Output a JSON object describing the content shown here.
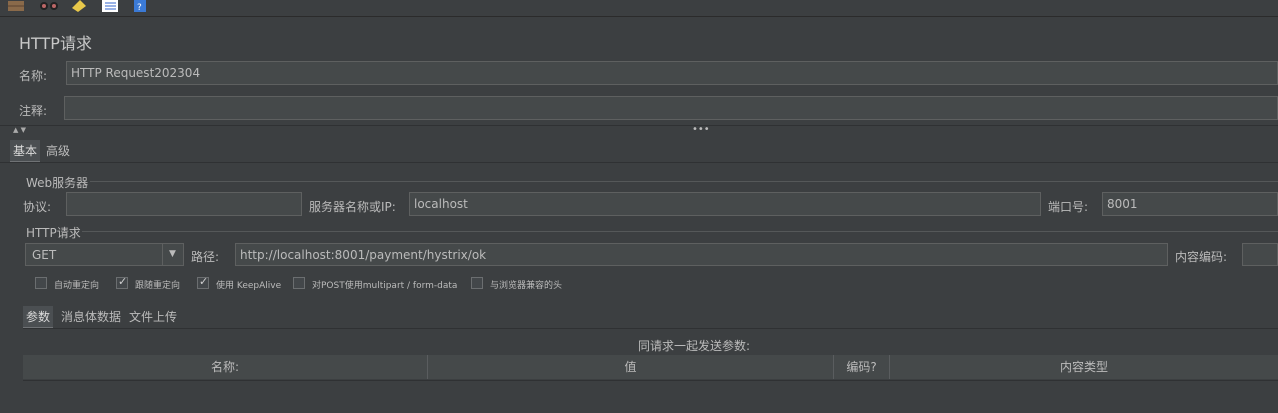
{
  "panel_title": "HTTP请求",
  "name_label": "名称:",
  "name_value": "HTTP Request202304",
  "comment_label": "注释:",
  "comment_value": "",
  "tabs": [
    "基本",
    "高级"
  ],
  "web_server": {
    "group_label": "Web服务器",
    "protocol_label": "协议:",
    "protocol_value": "",
    "server_label": "服务器名称或IP:",
    "server_value": "localhost",
    "port_label": "端口号:",
    "port_value": "8001"
  },
  "http_request": {
    "group_label": "HTTP请求",
    "method": "GET",
    "path_label": "路径:",
    "path_value": "http://localhost:8001/payment/hystrix/ok",
    "encoding_label": "内容编码:",
    "encoding_value": ""
  },
  "options": [
    {
      "label": "自动重定向",
      "checked": false
    },
    {
      "label": "跟随重定向",
      "checked": true
    },
    {
      "label": "使用 KeepAlive",
      "checked": true
    },
    {
      "label": "对POST使用multipart / form-data",
      "checked": false
    },
    {
      "label": "与浏览器兼容的头",
      "checked": false
    }
  ],
  "sub_tabs": [
    "参数",
    "消息体数据",
    "文件上传"
  ],
  "params_caption": "同请求一起发送参数:",
  "table_headers": [
    "名称:",
    "值",
    "编码?",
    "内容类型"
  ]
}
